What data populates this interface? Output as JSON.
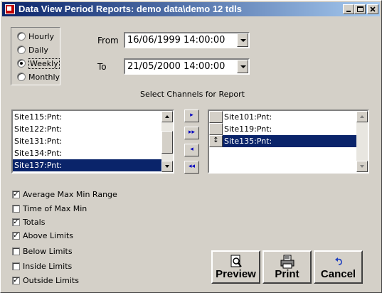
{
  "window": {
    "title": "Data View Period Reports: demo data\\demo 12 tdls",
    "controls": [
      "minimize",
      "maximize",
      "close"
    ]
  },
  "period": {
    "options": [
      "Hourly",
      "Daily",
      "Weekly",
      "Monthly"
    ],
    "selected": "Weekly"
  },
  "range": {
    "from_label": "From",
    "from_value": "16/06/1999 14:00:00",
    "to_label": "To",
    "to_value": "21/05/2000 14:00:00"
  },
  "channels": {
    "heading": "Select Channels for Report",
    "available": [
      {
        "label": "Site115:Pnt:",
        "selected": false
      },
      {
        "label": "Site122:Pnt:",
        "selected": false
      },
      {
        "label": "Site131:Pnt:",
        "selected": false
      },
      {
        "label": "Site134:Pnt:",
        "selected": false
      },
      {
        "label": "Site137:Pnt:",
        "selected": true
      }
    ],
    "chosen": [
      {
        "label": "Site101:Pnt:",
        "selected": false
      },
      {
        "label": "Site119:Pnt:",
        "selected": false
      },
      {
        "label": "Site135:Pnt:",
        "selected": true
      }
    ],
    "move_buttons": [
      {
        "name": "move-right-button",
        "glyph": "▸"
      },
      {
        "name": "move-all-right-button",
        "glyph": "▸▸"
      },
      {
        "name": "move-left-button",
        "glyph": "◂"
      },
      {
        "name": "move-all-left-button",
        "glyph": "◂◂"
      }
    ]
  },
  "options": [
    {
      "label": "Average Max Min Range",
      "checked": true
    },
    {
      "label": "Time of Max Min",
      "checked": false
    },
    {
      "label": "Totals",
      "checked": true
    },
    {
      "label": "Above Limits",
      "checked": true
    },
    {
      "label": "Below Limits",
      "checked": false
    },
    {
      "label": "Inside Limits",
      "checked": false
    },
    {
      "label": "Outside Limits",
      "checked": true
    }
  ],
  "buttons": {
    "preview": "Preview",
    "print": "Print",
    "cancel": "Cancel"
  },
  "colors": {
    "title_start": "#0a246a",
    "title_end": "#a6caf0",
    "selection": "#0a246a",
    "face": "#d4d0c8"
  }
}
